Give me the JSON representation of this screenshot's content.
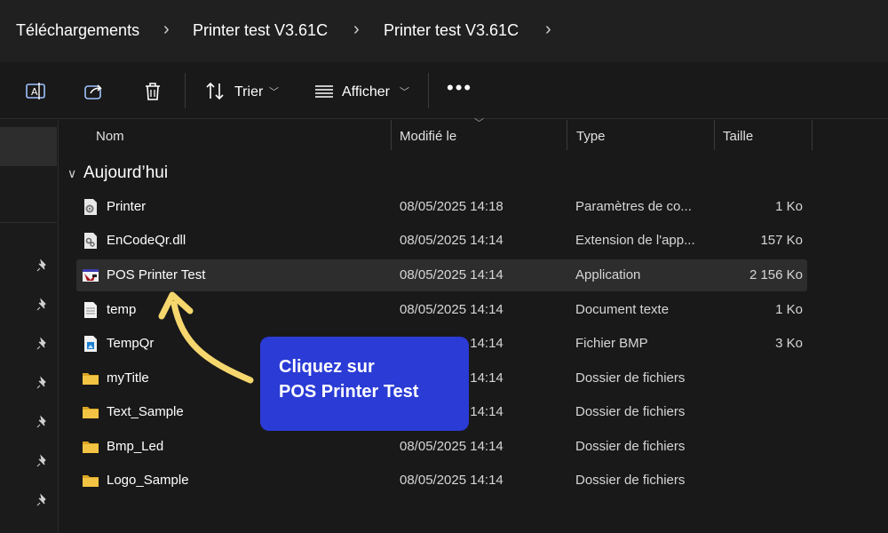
{
  "breadcrumb": [
    "Téléchargements",
    "Printer test V3.61C",
    "Printer test V3.61C"
  ],
  "toolbar": {
    "sort_label": "Trier",
    "view_label": "Afficher",
    "more_label": "•••"
  },
  "columns": {
    "name": "Nom",
    "modified": "Modifié le",
    "type": "Type",
    "size": "Taille"
  },
  "group": {
    "label": "Aujourd’hui",
    "chevron": "∨"
  },
  "files": [
    {
      "name": "Printer",
      "modified": "08/05/2025 14:18",
      "type": "Paramètres de co...",
      "size": "1 Ko",
      "icon": "settings-file-icon"
    },
    {
      "name": "EnCodeQr.dll",
      "modified": "08/05/2025 14:14",
      "type": "Extension de l'app...",
      "size": "157 Ko",
      "icon": "dll-file-icon"
    },
    {
      "name": "POS Printer Test",
      "modified": "08/05/2025 14:14",
      "type": "Application",
      "size": "2 156 Ko",
      "icon": "application-icon"
    },
    {
      "name": "temp",
      "modified": "08/05/2025 14:14",
      "type": "Document texte",
      "size": "1 Ko",
      "icon": "text-document-icon"
    },
    {
      "name": "TempQr",
      "modified": "08/05/2025 14:14",
      "type": "Fichier BMP",
      "size": "3 Ko",
      "icon": "bmp-image-icon"
    },
    {
      "name": "myTitle",
      "modified": "08/05/2025 14:14",
      "type": "Dossier de fichiers",
      "size": "",
      "icon": "folder-icon"
    },
    {
      "name": "Text_Sample",
      "modified": "08/05/2025 14:14",
      "type": "Dossier de fichiers",
      "size": "",
      "icon": "folder-icon"
    },
    {
      "name": "Bmp_Led",
      "modified": "08/05/2025 14:14",
      "type": "Dossier de fichiers",
      "size": "",
      "icon": "folder-icon"
    },
    {
      "name": "Logo_Sample",
      "modified": "08/05/2025 14:14",
      "type": "Dossier de fichiers",
      "size": "",
      "icon": "folder-icon"
    }
  ],
  "callout": {
    "line1": "Cliquez sur",
    "line2": "POS Printer Test"
  },
  "colors": {
    "accent": "#2b3bd6",
    "arrow": "#f5d76e",
    "folder": "#f3c443"
  }
}
